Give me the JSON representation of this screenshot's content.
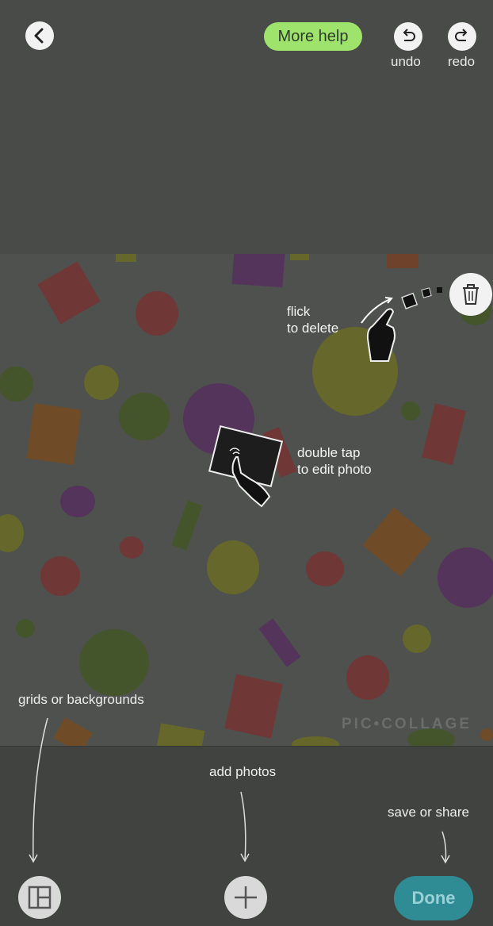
{
  "header": {
    "help_label": "More help",
    "undo_label": "undo",
    "redo_label": "redo"
  },
  "hints": {
    "flick_line1": "flick",
    "flick_line2": "to delete",
    "doubletap_line1": "double tap",
    "doubletap_line2": "to edit photo",
    "grids_label": "grids or backgrounds",
    "add_label": "add photos",
    "save_label": "save or share"
  },
  "watermark": "PIC•COLLAGE",
  "toolbar": {
    "done_label": "Done"
  },
  "icons": [
    "back-arrow-icon",
    "undo-icon",
    "redo-icon",
    "trash-icon",
    "flick-hand-icon",
    "double-tap-hand-icon",
    "layout-grid-icon",
    "plus-icon"
  ],
  "colors": {
    "help": "#9ee36c",
    "done": "#2f8c95"
  }
}
